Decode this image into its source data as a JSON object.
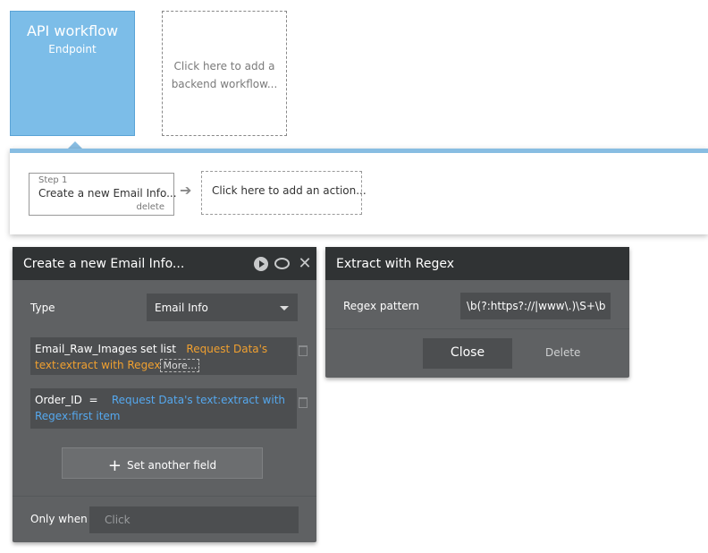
{
  "workflow": {
    "api_title": "API workflow",
    "api_subtitle": "Endpoint",
    "add_backend_line1": "Click here to add a",
    "add_backend_line2": "backend workflow..."
  },
  "steps": {
    "step_label": "Step 1",
    "step_name": "Create a new Email Info...",
    "step_delete": "delete",
    "add_action": "Click here to add an action..."
  },
  "action_panel": {
    "title": "Create a new Email Info...",
    "type_label": "Type",
    "type_value": "Email Info",
    "field1": {
      "name": "Email_Raw_Images set list",
      "expr": "Request Data's text:extract with Regex",
      "more": "More..."
    },
    "field2": {
      "name": "Order_ID",
      "operator": "=",
      "expr": "Request Data's text:extract with Regex:first item"
    },
    "set_field_label": "Set another field",
    "only_when_label": "Only when",
    "only_when_placeholder": "Click"
  },
  "regex_panel": {
    "title": "Extract with Regex",
    "pattern_label": "Regex pattern",
    "pattern_value": "\\b(?:https?://|www\\.)\\S+\\b",
    "close_label": "Close",
    "delete_label": "Delete"
  },
  "colors": {
    "api_card": "#7cbde8",
    "panel_bg": "#5f6163",
    "panel_header": "#303334",
    "orange_expr": "#f0a030",
    "blue_expr": "#55a8ee",
    "band_accent": "#88bde2"
  }
}
